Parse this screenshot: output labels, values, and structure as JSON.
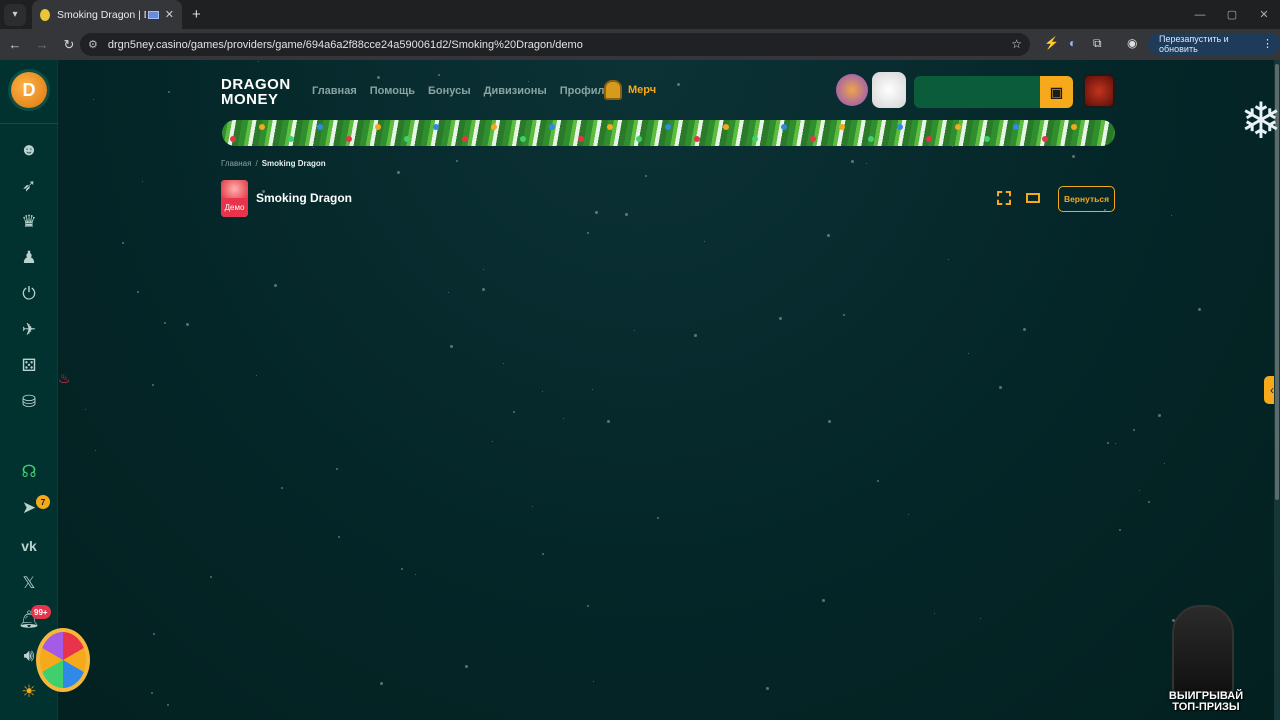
{
  "browser": {
    "tab_title": "Smoking Dragon | Dragon M",
    "tab_close": "✕",
    "new_tab": "+",
    "url": "drgn5ney.casino/games/providers/game/694a6a2f88cce24a590061d2/Smoking%20Dragon/demo",
    "relaunch_label": "Перезапустить и обновить",
    "window_controls": [
      "—",
      "▢",
      "✕"
    ]
  },
  "site": {
    "brand_line1": "DRAGON",
    "brand_line2": "MONEY",
    "nav": [
      "Главная",
      "Помощь",
      "Бонусы",
      "Дивизионы",
      "Профиль"
    ],
    "merch_label": "Мерч",
    "wallet_icon": "▣"
  },
  "sidebar": {
    "items": [
      "smile-icon",
      "rocket-icon",
      "trophy-icon",
      "user-icon",
      "power-icon",
      "rocket2-icon",
      "dice-icon",
      "bag-icon"
    ],
    "bottom": [
      "support-icon",
      "telegram-icon",
      "vk-icon",
      "x-icon",
      "bell-icon",
      "sound-icon",
      "lightbulb-icon"
    ],
    "telegram_badge": "7",
    "notifications_badge": "99+"
  },
  "content": {
    "breadcrumb_home": "Главная",
    "breadcrumb_sep": "/",
    "breadcrumb_current": "Smoking Dragon",
    "game_badge": "Демо",
    "game_title": "Smoking Dragon",
    "back_button": "Вернуться"
  },
  "promo": {
    "line1": "ВЫИГРЫВАЙ",
    "line2": "ТОП-ПРИЗЫ"
  },
  "colors": {
    "accent": "#f6a91a",
    "background": "#04282a",
    "sidebar": "#02322f"
  }
}
